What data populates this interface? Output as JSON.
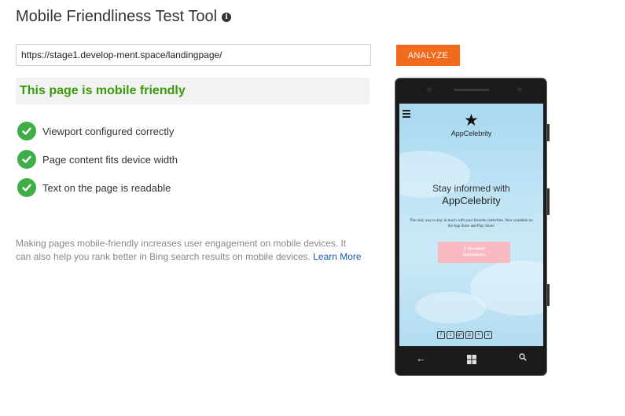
{
  "page": {
    "title": "Mobile Friendliness Test Tool",
    "info_icon_glyph": "i"
  },
  "form": {
    "url_value": "https://stage1.develop-ment.space/landingpage/",
    "analyze_label": "ANALYZE"
  },
  "result": {
    "status": "This page is mobile friendly",
    "checks": [
      "Viewport configured correctly",
      "Page content fits device width",
      "Text on the page is readable"
    ]
  },
  "info": {
    "text": "Making pages mobile-friendly increases user engagement on mobile devices. It can also help you rank better in Bing search results on mobile devices.",
    "link_label": "Learn More"
  },
  "preview": {
    "brand": "AppCelebrity",
    "headline_line1": "Stay informed with",
    "headline_line2": "AppCelebrity",
    "subtext": "The only way to stay in touch with your favorite celebrities. Now available on the App Store and Play Store!",
    "download_line1": "Download",
    "download_line2": "AppCelebrity",
    "social_icons": [
      "f",
      "t",
      "g+",
      "p",
      "<",
      "v"
    ]
  },
  "colors": {
    "accent_orange": "#f26a1b",
    "success_green": "#3a9a0a",
    "check_green": "#3fae49",
    "link_blue": "#1a5bb5"
  }
}
